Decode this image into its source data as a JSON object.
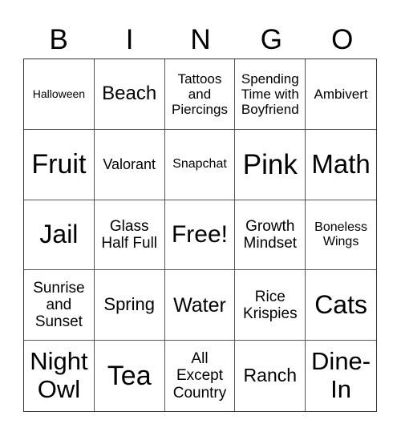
{
  "header": {
    "letters": [
      "B",
      "I",
      "N",
      "G",
      "O"
    ]
  },
  "cells": [
    {
      "text": "Halloween",
      "size": "s14"
    },
    {
      "text": "Beach",
      "size": "s24"
    },
    {
      "text": "Tattoos and Piercings",
      "size": "s17"
    },
    {
      "text": "Spending Time with Boyfriend",
      "size": "s17"
    },
    {
      "text": "Ambivert",
      "size": "s17"
    },
    {
      "text": "Fruit",
      "size": "s34"
    },
    {
      "text": "Valorant",
      "size": "s18"
    },
    {
      "text": "Snapchat",
      "size": "s16"
    },
    {
      "text": "Pink",
      "size": "s35"
    },
    {
      "text": "Math",
      "size": "s33"
    },
    {
      "text": "Jail",
      "size": "s32"
    },
    {
      "text": "Glass Half Full",
      "size": "s19"
    },
    {
      "text": "Free!",
      "size": "s30"
    },
    {
      "text": "Growth Mindset",
      "size": "s19"
    },
    {
      "text": "Boneless Wings",
      "size": "s16"
    },
    {
      "text": "Sunrise and Sunset",
      "size": "s19"
    },
    {
      "text": "Spring",
      "size": "s22"
    },
    {
      "text": "Water",
      "size": "s25"
    },
    {
      "text": "Rice Krispies",
      "size": "s19"
    },
    {
      "text": "Cats",
      "size": "s32"
    },
    {
      "text": "Night Owl",
      "size": "s31"
    },
    {
      "text": "Tea",
      "size": "s34"
    },
    {
      "text": "All Except Country",
      "size": "s19"
    },
    {
      "text": "Ranch",
      "size": "s23"
    },
    {
      "text": "Dine-In",
      "size": "s31"
    }
  ]
}
